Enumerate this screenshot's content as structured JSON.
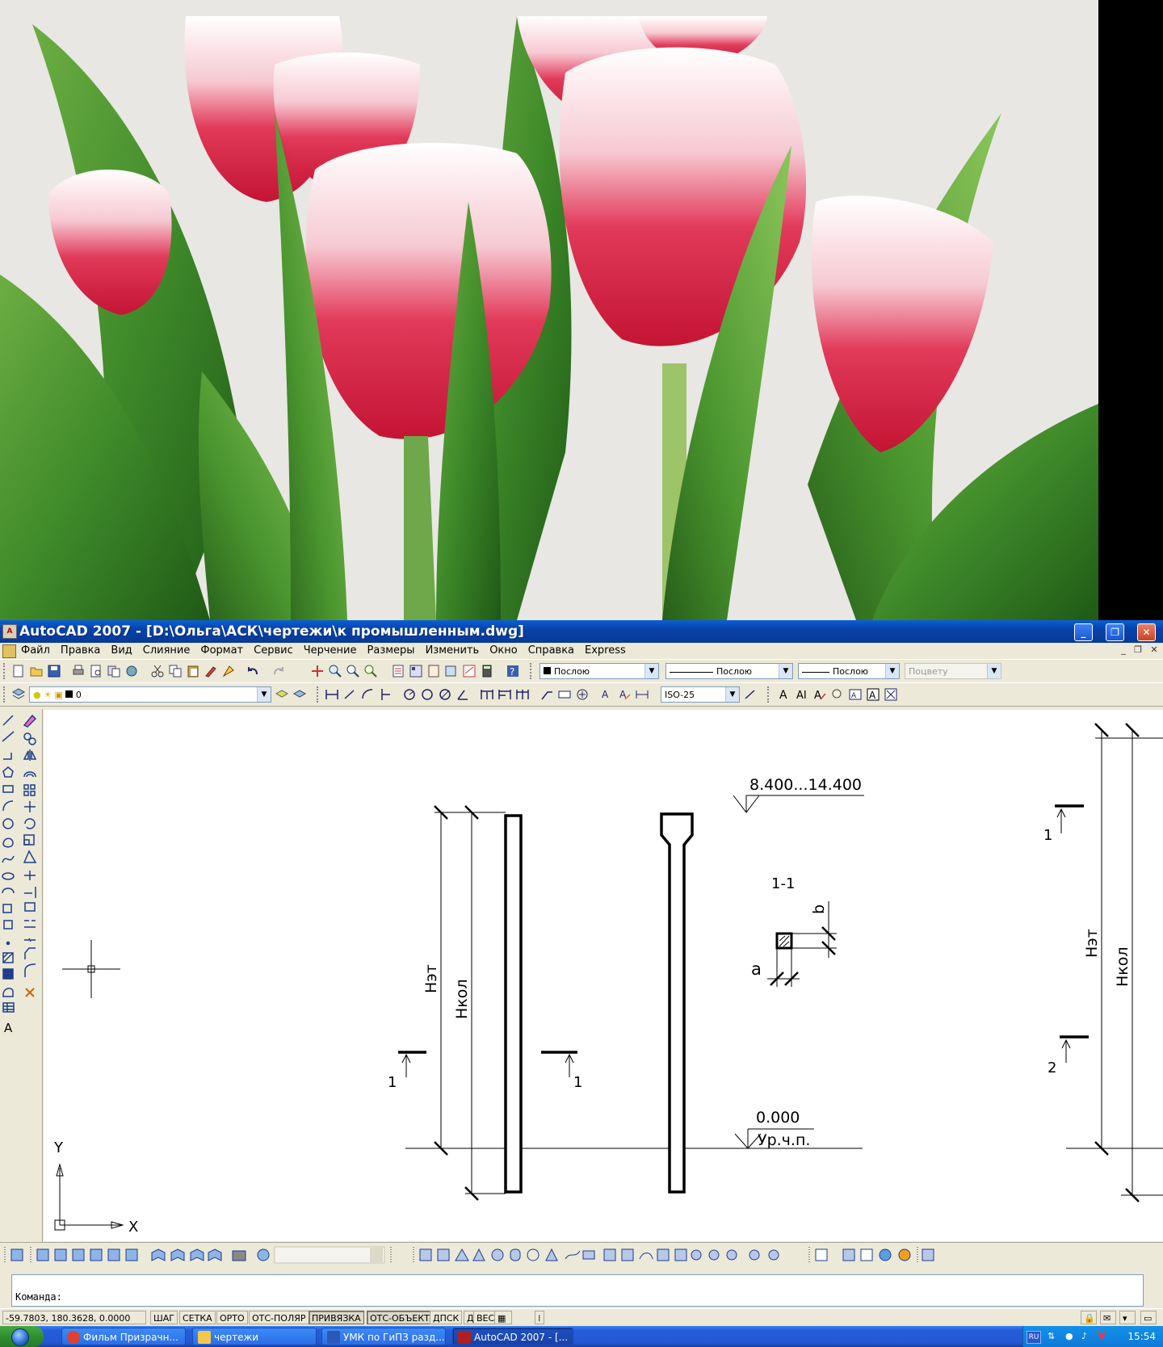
{
  "window": {
    "app_icon_label": "A",
    "title": "AutoCAD 2007 - [D:\\Ольга\\АСК\\чертежи\\к промышленным.dwg]",
    "minimize_label": "_",
    "maximize_label": "❐",
    "close_label": "✕"
  },
  "menu": {
    "items": [
      "Файл",
      "Правка",
      "Вид",
      "Слияние",
      "Формат",
      "Сервис",
      "Черчение",
      "Размеры",
      "Изменить",
      "Окно",
      "Справка",
      "Express"
    ],
    "doc_minimize": "_",
    "doc_restore": "❐",
    "doc_close": "✕"
  },
  "properties": {
    "color_value": "Послою",
    "linetype_value": "Послою",
    "lineweight_value": "Послою",
    "plotstyle_value": "Поцвету"
  },
  "layers": {
    "current_layer": "0",
    "dimstyle": "ISO-25"
  },
  "drawing": {
    "level_top": "8.400...14.400",
    "section_title": "1-1",
    "dim_b": "b",
    "dim_a": "a",
    "label_h_floor": "Hэт",
    "label_h_column": "Hкол",
    "section_mark_1": "1",
    "section_mark_2": "2",
    "level_zero": "0.000",
    "ground_level": "Ур.ч.п.",
    "ucs_x": "X",
    "ucs_y": "Y"
  },
  "command": {
    "prompt": "Команда:"
  },
  "status": {
    "coords": "-59.7803, 180.3628, 0.0000",
    "buttons": [
      {
        "label": "ШАГ",
        "on": false
      },
      {
        "label": "СЕТКА",
        "on": false
      },
      {
        "label": "ОРТО",
        "on": false
      },
      {
        "label": "ОТС-ПОЛЯР",
        "on": false
      },
      {
        "label": "ПРИВЯЗКА",
        "on": true
      },
      {
        "label": "ОТС-ОБЪЕКТ",
        "on": true
      },
      {
        "label": "ДПСК",
        "on": false
      },
      {
        "label": "ДИН",
        "on": false
      },
      {
        "label": "ВЕС",
        "on": false
      }
    ]
  },
  "taskbar": {
    "tasks": [
      {
        "label": "Фильм Призрачн...",
        "active": false
      },
      {
        "label": "чертежи",
        "active": false
      },
      {
        "label": "УМК по ГиПЗ разд...",
        "active": false
      },
      {
        "label": "AutoCAD 2007 - [...",
        "active": true
      }
    ],
    "lang": "RU",
    "clock": "15:54"
  },
  "colors": {
    "titlebar": "#0842a8",
    "tulip_red": "#d8213f",
    "leaf_green": "#3f8a2a",
    "canvas": "#ffffff"
  }
}
